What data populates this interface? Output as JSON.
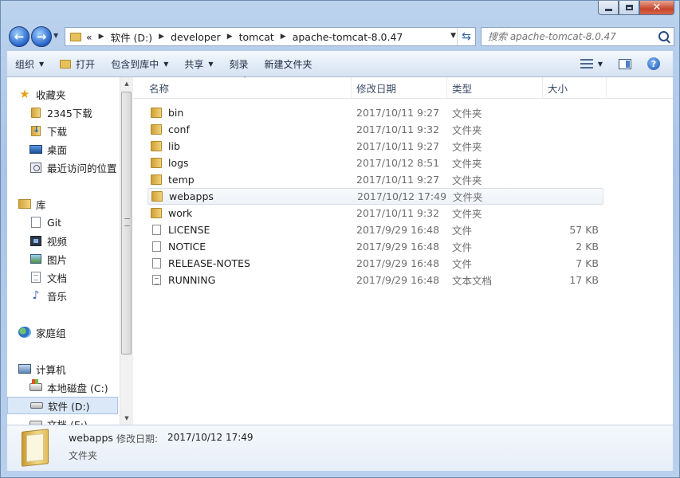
{
  "window": {
    "address": {
      "overflow": "«",
      "crumbs": [
        "软件 (D:)",
        "developer",
        "tomcat",
        "apache-tomcat-8.0.47"
      ]
    },
    "search": {
      "placeholder": "搜索 apache-tomcat-8.0.47"
    }
  },
  "toolbar": {
    "organize": "组织",
    "open": "打开",
    "include_in_library": "包含到库中",
    "share": "共享",
    "burn": "刻录",
    "new_folder": "新建文件夹"
  },
  "sidebar": {
    "favorites": {
      "label": "收藏夹",
      "items": [
        "2345下载",
        "下载",
        "桌面",
        "最近访问的位置"
      ]
    },
    "libraries": {
      "label": "库",
      "items": [
        "Git",
        "视频",
        "图片",
        "文档",
        "音乐"
      ]
    },
    "homegroup": "家庭组",
    "computer": {
      "label": "计算机",
      "items": [
        "本地磁盘 (C:)",
        "软件 (D:)",
        "文档 (E:)"
      ]
    }
  },
  "columns": {
    "name": "名称",
    "modified": "修改日期",
    "type": "类型",
    "size": "大小"
  },
  "files": [
    {
      "name": "bin",
      "modified": "2017/10/11 9:27",
      "type": "文件夹",
      "size": "",
      "kind": "folder"
    },
    {
      "name": "conf",
      "modified": "2017/10/11 9:32",
      "type": "文件夹",
      "size": "",
      "kind": "folder"
    },
    {
      "name": "lib",
      "modified": "2017/10/11 9:27",
      "type": "文件夹",
      "size": "",
      "kind": "folder"
    },
    {
      "name": "logs",
      "modified": "2017/10/12 8:51",
      "type": "文件夹",
      "size": "",
      "kind": "folder"
    },
    {
      "name": "temp",
      "modified": "2017/10/11 9:27",
      "type": "文件夹",
      "size": "",
      "kind": "folder"
    },
    {
      "name": "webapps",
      "modified": "2017/10/12 17:49",
      "type": "文件夹",
      "size": "",
      "kind": "folder"
    },
    {
      "name": "work",
      "modified": "2017/10/11 9:32",
      "type": "文件夹",
      "size": "",
      "kind": "folder"
    },
    {
      "name": "LICENSE",
      "modified": "2017/9/29 16:48",
      "type": "文件",
      "size": "57 KB",
      "kind": "file"
    },
    {
      "name": "NOTICE",
      "modified": "2017/9/29 16:48",
      "type": "文件",
      "size": "2 KB",
      "kind": "file"
    },
    {
      "name": "RELEASE-NOTES",
      "modified": "2017/9/29 16:48",
      "type": "文件",
      "size": "7 KB",
      "kind": "file"
    },
    {
      "name": "RUNNING",
      "modified": "2017/9/29 16:48",
      "type": "文本文档",
      "size": "17 KB",
      "kind": "text"
    }
  ],
  "details": {
    "name": "webapps",
    "modified_label": "修改日期:",
    "modified_value": "2017/10/12 17:49",
    "type": "文件夹"
  }
}
